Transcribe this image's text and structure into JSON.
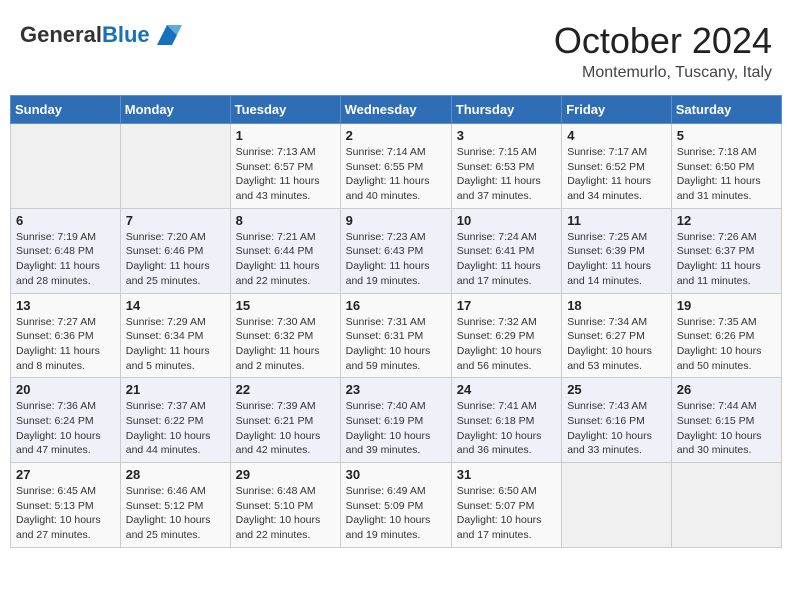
{
  "logo": {
    "general": "General",
    "blue": "Blue"
  },
  "title": "October 2024",
  "location": "Montemurlo, Tuscany, Italy",
  "weekdays": [
    "Sunday",
    "Monday",
    "Tuesday",
    "Wednesday",
    "Thursday",
    "Friday",
    "Saturday"
  ],
  "weeks": [
    [
      {
        "day": "",
        "info": ""
      },
      {
        "day": "",
        "info": ""
      },
      {
        "day": "1",
        "info": "Sunrise: 7:13 AM\nSunset: 6:57 PM\nDaylight: 11 hours and 43 minutes."
      },
      {
        "day": "2",
        "info": "Sunrise: 7:14 AM\nSunset: 6:55 PM\nDaylight: 11 hours and 40 minutes."
      },
      {
        "day": "3",
        "info": "Sunrise: 7:15 AM\nSunset: 6:53 PM\nDaylight: 11 hours and 37 minutes."
      },
      {
        "day": "4",
        "info": "Sunrise: 7:17 AM\nSunset: 6:52 PM\nDaylight: 11 hours and 34 minutes."
      },
      {
        "day": "5",
        "info": "Sunrise: 7:18 AM\nSunset: 6:50 PM\nDaylight: 11 hours and 31 minutes."
      }
    ],
    [
      {
        "day": "6",
        "info": "Sunrise: 7:19 AM\nSunset: 6:48 PM\nDaylight: 11 hours and 28 minutes."
      },
      {
        "day": "7",
        "info": "Sunrise: 7:20 AM\nSunset: 6:46 PM\nDaylight: 11 hours and 25 minutes."
      },
      {
        "day": "8",
        "info": "Sunrise: 7:21 AM\nSunset: 6:44 PM\nDaylight: 11 hours and 22 minutes."
      },
      {
        "day": "9",
        "info": "Sunrise: 7:23 AM\nSunset: 6:43 PM\nDaylight: 11 hours and 19 minutes."
      },
      {
        "day": "10",
        "info": "Sunrise: 7:24 AM\nSunset: 6:41 PM\nDaylight: 11 hours and 17 minutes."
      },
      {
        "day": "11",
        "info": "Sunrise: 7:25 AM\nSunset: 6:39 PM\nDaylight: 11 hours and 14 minutes."
      },
      {
        "day": "12",
        "info": "Sunrise: 7:26 AM\nSunset: 6:37 PM\nDaylight: 11 hours and 11 minutes."
      }
    ],
    [
      {
        "day": "13",
        "info": "Sunrise: 7:27 AM\nSunset: 6:36 PM\nDaylight: 11 hours and 8 minutes."
      },
      {
        "day": "14",
        "info": "Sunrise: 7:29 AM\nSunset: 6:34 PM\nDaylight: 11 hours and 5 minutes."
      },
      {
        "day": "15",
        "info": "Sunrise: 7:30 AM\nSunset: 6:32 PM\nDaylight: 11 hours and 2 minutes."
      },
      {
        "day": "16",
        "info": "Sunrise: 7:31 AM\nSunset: 6:31 PM\nDaylight: 10 hours and 59 minutes."
      },
      {
        "day": "17",
        "info": "Sunrise: 7:32 AM\nSunset: 6:29 PM\nDaylight: 10 hours and 56 minutes."
      },
      {
        "day": "18",
        "info": "Sunrise: 7:34 AM\nSunset: 6:27 PM\nDaylight: 10 hours and 53 minutes."
      },
      {
        "day": "19",
        "info": "Sunrise: 7:35 AM\nSunset: 6:26 PM\nDaylight: 10 hours and 50 minutes."
      }
    ],
    [
      {
        "day": "20",
        "info": "Sunrise: 7:36 AM\nSunset: 6:24 PM\nDaylight: 10 hours and 47 minutes."
      },
      {
        "day": "21",
        "info": "Sunrise: 7:37 AM\nSunset: 6:22 PM\nDaylight: 10 hours and 44 minutes."
      },
      {
        "day": "22",
        "info": "Sunrise: 7:39 AM\nSunset: 6:21 PM\nDaylight: 10 hours and 42 minutes."
      },
      {
        "day": "23",
        "info": "Sunrise: 7:40 AM\nSunset: 6:19 PM\nDaylight: 10 hours and 39 minutes."
      },
      {
        "day": "24",
        "info": "Sunrise: 7:41 AM\nSunset: 6:18 PM\nDaylight: 10 hours and 36 minutes."
      },
      {
        "day": "25",
        "info": "Sunrise: 7:43 AM\nSunset: 6:16 PM\nDaylight: 10 hours and 33 minutes."
      },
      {
        "day": "26",
        "info": "Sunrise: 7:44 AM\nSunset: 6:15 PM\nDaylight: 10 hours and 30 minutes."
      }
    ],
    [
      {
        "day": "27",
        "info": "Sunrise: 6:45 AM\nSunset: 5:13 PM\nDaylight: 10 hours and 27 minutes."
      },
      {
        "day": "28",
        "info": "Sunrise: 6:46 AM\nSunset: 5:12 PM\nDaylight: 10 hours and 25 minutes."
      },
      {
        "day": "29",
        "info": "Sunrise: 6:48 AM\nSunset: 5:10 PM\nDaylight: 10 hours and 22 minutes."
      },
      {
        "day": "30",
        "info": "Sunrise: 6:49 AM\nSunset: 5:09 PM\nDaylight: 10 hours and 19 minutes."
      },
      {
        "day": "31",
        "info": "Sunrise: 6:50 AM\nSunset: 5:07 PM\nDaylight: 10 hours and 17 minutes."
      },
      {
        "day": "",
        "info": ""
      },
      {
        "day": "",
        "info": ""
      }
    ]
  ]
}
